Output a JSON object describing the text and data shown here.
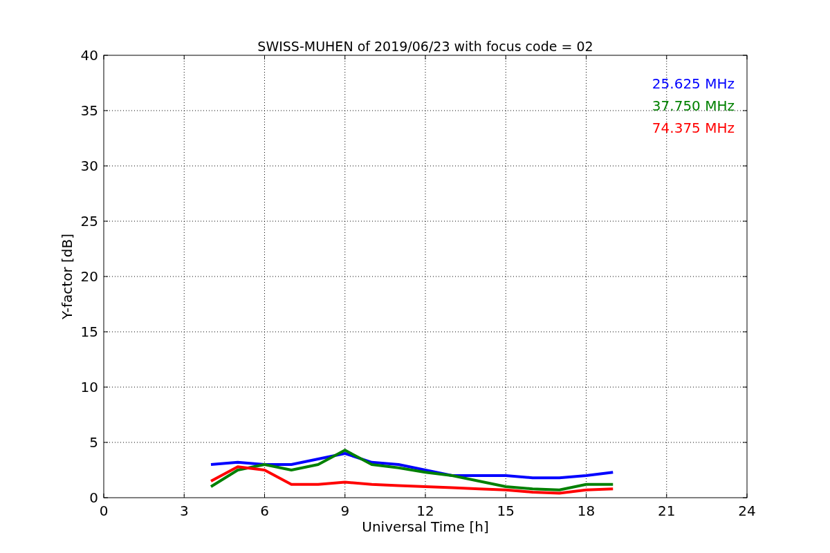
{
  "figure": {
    "chart_data": {
      "type": "line",
      "title": "SWISS-MUHEN of 2019/06/23 with focus code = 02",
      "xlabel": "Universal Time [h]",
      "ylabel": "Y-factor [dB]",
      "x": [
        4,
        5,
        6,
        7,
        8,
        9,
        10,
        11,
        12,
        13,
        14,
        15,
        16,
        17,
        18,
        19
      ],
      "series": [
        {
          "name": "25.625 MHz",
          "color": "#0000ff",
          "values": [
            3,
            3.2,
            3,
            3,
            3.5,
            4,
            3.2,
            3,
            2.5,
            2,
            2,
            2,
            1.8,
            1.8,
            2,
            2.3
          ]
        },
        {
          "name": "37.750 MHz",
          "color": "#008000",
          "values": [
            1,
            2.5,
            3,
            2.5,
            3,
            4.3,
            3,
            2.7,
            2.3,
            2,
            1.5,
            1,
            0.8,
            0.7,
            1.2,
            1.2
          ]
        },
        {
          "name": "74.375 MHz",
          "color": "#ff0000",
          "values": [
            1.5,
            2.8,
            2.5,
            1.2,
            1.2,
            1.4,
            1.2,
            1.1,
            1,
            0.9,
            0.8,
            0.7,
            0.5,
            0.4,
            0.7,
            0.8
          ]
        }
      ],
      "grid": true,
      "xlim": [
        0,
        24
      ],
      "ylim": [
        0,
        40
      ],
      "xticks": [
        0,
        3,
        6,
        9,
        12,
        15,
        18,
        21,
        24
      ],
      "yticks": [
        0,
        5,
        10,
        15,
        20,
        25,
        30,
        35,
        40
      ]
    }
  }
}
